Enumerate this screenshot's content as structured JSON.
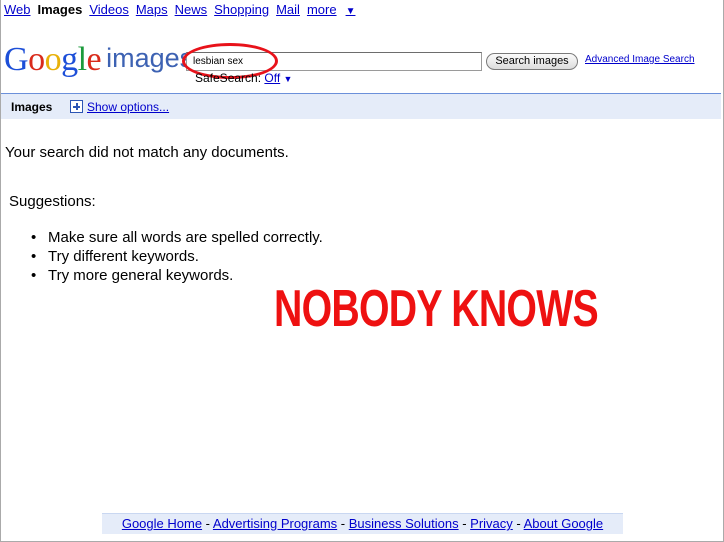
{
  "nav": {
    "items": [
      {
        "label": "Web",
        "current": false
      },
      {
        "label": "Images",
        "current": true
      },
      {
        "label": "Videos",
        "current": false
      },
      {
        "label": "Maps",
        "current": false
      },
      {
        "label": "News",
        "current": false
      },
      {
        "label": "Shopping",
        "current": false
      },
      {
        "label": "Mail",
        "current": false
      }
    ],
    "more_label": "more",
    "more_arrow": "▼"
  },
  "logo": {
    "letters": [
      "G",
      "o",
      "o",
      "g",
      "l",
      "e"
    ],
    "suffix": "images",
    "colors": {
      "blue": "#1d4fd8",
      "red": "#d92b1b",
      "yellow": "#e8b10a",
      "green": "#1b9a3b",
      "suffix": "#3d62b3"
    }
  },
  "search": {
    "query": "lesbian sex",
    "button_label": "Search images",
    "advanced_label": "Advanced Image Search",
    "safesearch_label": "SafeSearch:",
    "safesearch_value": "Off",
    "safesearch_arrow": "▼",
    "highlight_color": "#e8121a"
  },
  "result_bar": {
    "title": "Images",
    "show_options_label": "Show options..."
  },
  "results": {
    "message": "Your search did not match any documents.",
    "suggestions_title": "Suggestions:",
    "suggestions": [
      "Make sure all words are spelled correctly.",
      "Try different keywords.",
      "Try more general keywords."
    ]
  },
  "overlay": {
    "text": "NOBODY KNOWS",
    "color": "#ee1111"
  },
  "footer": {
    "links": [
      "Google Home",
      "Advertising Programs",
      "Business Solutions",
      "Privacy",
      "About Google"
    ],
    "separator": " - "
  }
}
